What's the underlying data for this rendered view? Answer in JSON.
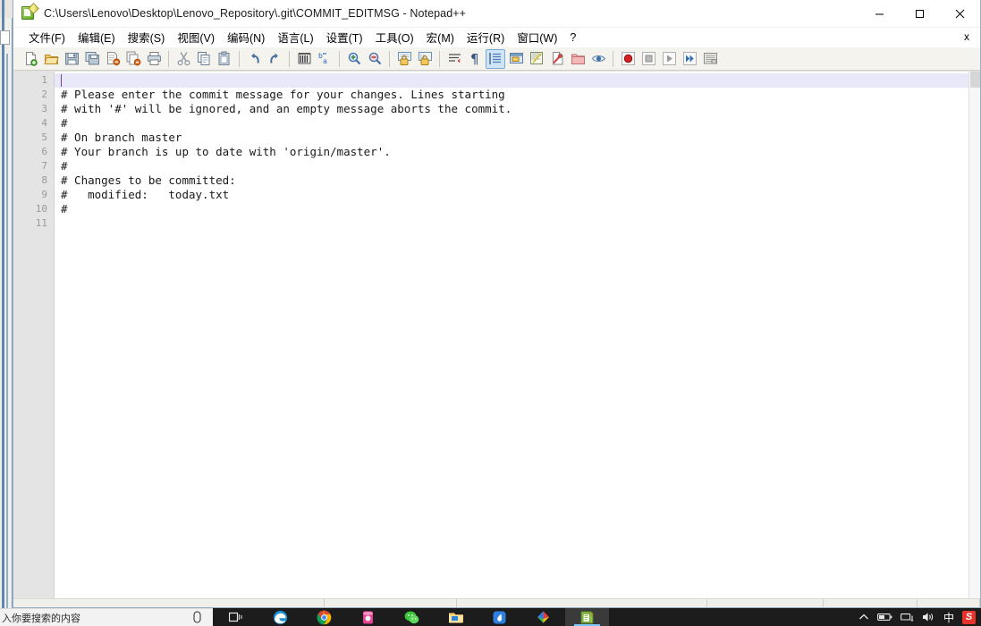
{
  "window": {
    "title": "C:\\Users\\Lenovo\\Desktop\\Lenovo_Repository\\.git\\COMMIT_EDITMSG - Notepad++",
    "app_icon": "notepad-plus-plus-icon",
    "controls": {
      "minimize": "minimize-icon",
      "maximize": "maximize-icon",
      "close": "close-icon"
    },
    "document_close_label": "x"
  },
  "menubar": {
    "items": [
      {
        "label": "文件(F)",
        "name": "menu-file"
      },
      {
        "label": "编辑(E)",
        "name": "menu-edit"
      },
      {
        "label": "搜索(S)",
        "name": "menu-search"
      },
      {
        "label": "视图(V)",
        "name": "menu-view"
      },
      {
        "label": "编码(N)",
        "name": "menu-encoding"
      },
      {
        "label": "语言(L)",
        "name": "menu-language"
      },
      {
        "label": "设置(T)",
        "name": "menu-settings"
      },
      {
        "label": "工具(O)",
        "name": "menu-tools"
      },
      {
        "label": "宏(M)",
        "name": "menu-macro"
      },
      {
        "label": "运行(R)",
        "name": "menu-run"
      },
      {
        "label": "窗口(W)",
        "name": "menu-window"
      },
      {
        "label": "?",
        "name": "menu-help"
      }
    ]
  },
  "toolbar": {
    "buttons": [
      {
        "icon": "new-file-icon",
        "tooltip": "新建"
      },
      {
        "icon": "open-file-icon",
        "tooltip": "打开"
      },
      {
        "icon": "save-icon",
        "tooltip": "保存"
      },
      {
        "icon": "save-all-icon",
        "tooltip": "保存所有"
      },
      {
        "icon": "close-file-icon",
        "tooltip": "关闭"
      },
      {
        "icon": "close-all-icon",
        "tooltip": "关闭所有"
      },
      {
        "icon": "print-icon",
        "tooltip": "打印"
      },
      {
        "icon": "separator",
        "tooltip": ""
      },
      {
        "icon": "cut-icon",
        "tooltip": "剪切"
      },
      {
        "icon": "copy-icon",
        "tooltip": "复制"
      },
      {
        "icon": "paste-icon",
        "tooltip": "粘贴"
      },
      {
        "icon": "separator",
        "tooltip": ""
      },
      {
        "icon": "undo-icon",
        "tooltip": "撤销"
      },
      {
        "icon": "redo-icon",
        "tooltip": "重做"
      },
      {
        "icon": "separator",
        "tooltip": ""
      },
      {
        "icon": "find-icon",
        "tooltip": "查找"
      },
      {
        "icon": "replace-icon",
        "tooltip": "替换"
      },
      {
        "icon": "separator",
        "tooltip": ""
      },
      {
        "icon": "zoom-in-icon",
        "tooltip": "放大"
      },
      {
        "icon": "zoom-out-icon",
        "tooltip": "缩小"
      },
      {
        "icon": "separator",
        "tooltip": ""
      },
      {
        "icon": "sync-v-scroll-icon",
        "tooltip": "同步垂直滚动"
      },
      {
        "icon": "sync-h-scroll-icon",
        "tooltip": "同步水平滚动"
      },
      {
        "icon": "separator",
        "tooltip": ""
      },
      {
        "icon": "word-wrap-icon",
        "tooltip": "自动换行"
      },
      {
        "icon": "show-all-chars-icon",
        "tooltip": "显示所有字符"
      },
      {
        "icon": "indent-guide-icon",
        "tooltip": "显示缩进参考线",
        "active": true
      },
      {
        "icon": "ui-dialog-icon",
        "tooltip": "用户定义语言"
      },
      {
        "icon": "doc-map-icon",
        "tooltip": "文档地图"
      },
      {
        "icon": "function-list-icon",
        "tooltip": "函数列表"
      },
      {
        "icon": "folder-workspace-icon",
        "tooltip": "文件夹作为工作区"
      },
      {
        "icon": "monitoring-icon",
        "tooltip": "监视文件"
      },
      {
        "icon": "separator",
        "tooltip": ""
      },
      {
        "icon": "record-macro-icon",
        "tooltip": "开始录制宏"
      },
      {
        "icon": "stop-macro-icon",
        "tooltip": "停止录制宏"
      },
      {
        "icon": "play-macro-icon",
        "tooltip": "播放宏"
      },
      {
        "icon": "play-multi-icon",
        "tooltip": "多次运行宏"
      },
      {
        "icon": "save-macro-icon",
        "tooltip": "保存当前录制宏"
      }
    ]
  },
  "editor": {
    "line_numbers": [
      "1",
      "2",
      "3",
      "4",
      "5",
      "6",
      "7",
      "8",
      "9",
      "10",
      "11"
    ],
    "current_line": 1,
    "lines": [
      "",
      "# Please enter the commit message for your changes. Lines starting",
      "# with '#' will be ignored, and an empty message aborts the commit.",
      "#",
      "# On branch master",
      "# Your branch is up to date with 'origin/master'.",
      "#",
      "# Changes to be committed:",
      "#   modified:   today.txt",
      "#",
      ""
    ]
  },
  "taskbar": {
    "search_placeholder": "入你要搜索的内容",
    "search_icon": "cortana-icon",
    "apps": [
      {
        "name": "task-view-icon",
        "label": "任务视图"
      },
      {
        "name": "edge-icon",
        "label": "Microsoft Edge"
      },
      {
        "name": "chrome-icon",
        "label": "Google Chrome"
      },
      {
        "name": "pink-app-icon",
        "label": "应用"
      },
      {
        "name": "wechat-icon",
        "label": "微信"
      },
      {
        "name": "file-explorer-icon",
        "label": "文件资源管理器"
      },
      {
        "name": "blue-app-icon",
        "label": "应用"
      },
      {
        "name": "colorful-app-icon",
        "label": "应用"
      },
      {
        "name": "notepad-plus-plus-icon",
        "label": "Notepad++",
        "running": true
      }
    ],
    "tray": [
      {
        "name": "show-hidden-icons-icon",
        "label": "显示隐藏的图标"
      },
      {
        "name": "battery-icon",
        "label": "电池"
      },
      {
        "name": "network-icon",
        "label": "网络"
      },
      {
        "name": "volume-icon",
        "label": "音量"
      },
      {
        "name": "ime-icon",
        "label": "中"
      },
      {
        "name": "sogou-icon",
        "label": "S"
      }
    ]
  },
  "colors": {
    "accent": "#7aa9d4",
    "current_line": "#e8e8f8",
    "gutter": "#e4e4e4",
    "taskbar": "#1c1c1c"
  }
}
